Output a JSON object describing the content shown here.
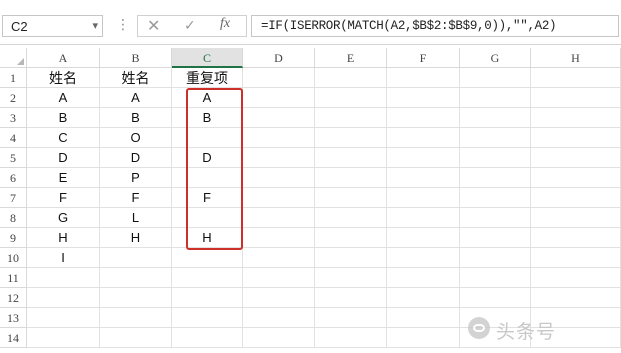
{
  "formula_bar": {
    "name_box": "C2",
    "dots": "⋮",
    "cancel_glyph": "✕",
    "enter_glyph": "✓",
    "fx_label": "fx",
    "formula": "=IF(ISERROR(MATCH(A2,$B$2:$B$9,0)),\"\",A2)"
  },
  "columns": [
    "A",
    "B",
    "C",
    "D",
    "E",
    "F",
    "G",
    "H"
  ],
  "active_column": "C",
  "rows": [
    "1",
    "2",
    "3",
    "4",
    "5",
    "6",
    "7",
    "8",
    "9",
    "10",
    "11",
    "12",
    "13",
    "14"
  ],
  "cells": {
    "A": [
      "姓名",
      "A",
      "B",
      "C",
      "D",
      "E",
      "F",
      "G",
      "H",
      "I",
      "",
      "",
      "",
      ""
    ],
    "B": [
      "姓名",
      "A",
      "B",
      "O",
      "D",
      "P",
      "F",
      "L",
      "H",
      "",
      "",
      "",
      "",
      ""
    ],
    "C": [
      "重复项",
      "A",
      "B",
      "",
      "D",
      "",
      "F",
      "",
      "H",
      "",
      "",
      "",
      "",
      ""
    ]
  },
  "highlight_color": "#cc3029",
  "icons": {
    "cancel": "close-icon",
    "enter": "check-icon",
    "fx": "function-icon",
    "name_box_dropdown": "chevron-down-icon",
    "watermark_logo": "chat-bubble-icon"
  },
  "watermark_text": "头条号"
}
